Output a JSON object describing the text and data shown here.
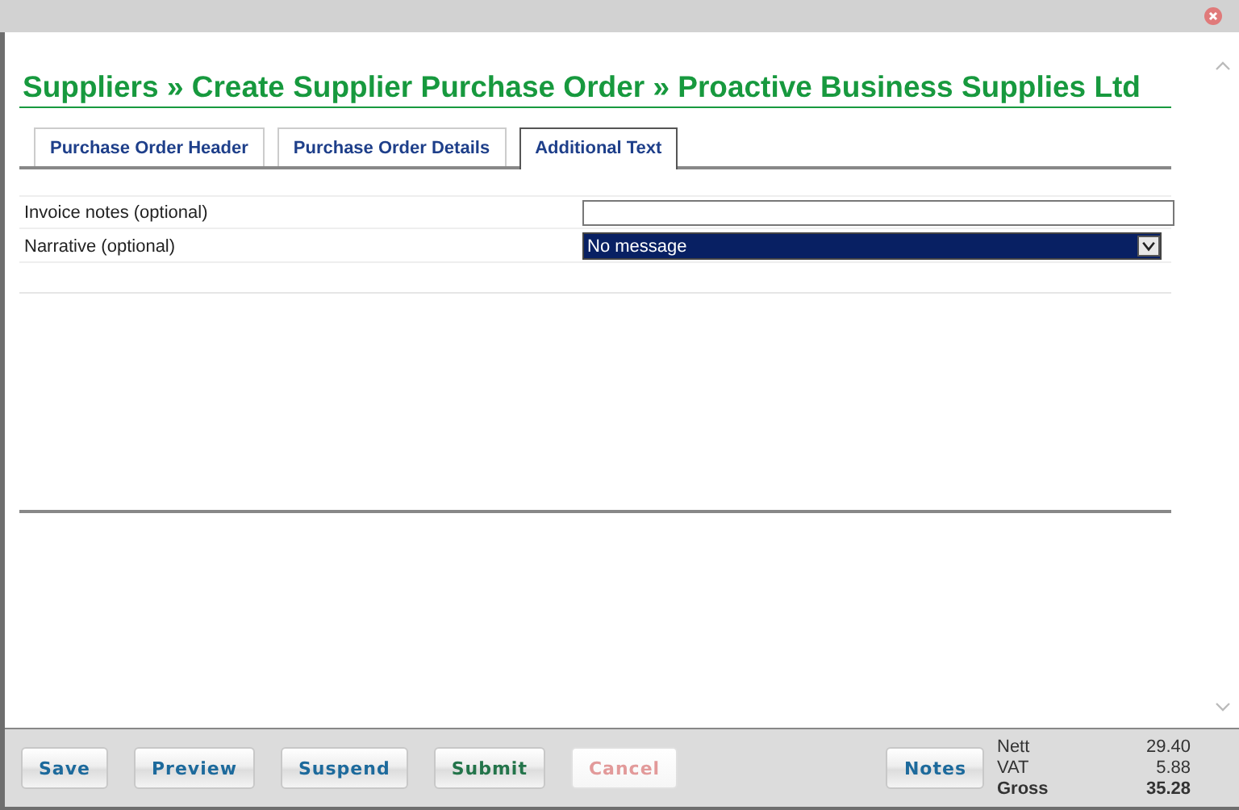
{
  "title": "Suppliers » Create Supplier Purchase Order » Proactive Business Supplies Ltd",
  "tabs": [
    {
      "label": "Purchase Order Header",
      "selected": false
    },
    {
      "label": "Purchase Order Details",
      "selected": false
    },
    {
      "label": "Additional Text",
      "selected": true
    }
  ],
  "fields": [
    {
      "kind": "text",
      "label": "Invoice notes (optional)"
    },
    {
      "kind": "select",
      "label": "Narrative (optional)",
      "value": "No message"
    }
  ],
  "buttons": [
    {
      "label": "Save",
      "color": "#1d6a9c",
      "disabled": false
    },
    {
      "label": "Preview",
      "color": "#1d6a9c",
      "disabled": false
    },
    {
      "label": "Suspend",
      "color": "#1d6a9c",
      "disabled": false
    },
    {
      "label": "Submit",
      "color": "#23744a",
      "disabled": false
    },
    {
      "label": "Cancel",
      "color": "#e29a9a",
      "disabled": true
    }
  ],
  "notes_button": {
    "label": "Notes",
    "color": "#1d6a9c"
  },
  "totals": [
    {
      "label": "Nett",
      "value": "29.40",
      "emphasis": false
    },
    {
      "label": "VAT",
      "value": "5.88",
      "emphasis": false
    },
    {
      "label": "Gross",
      "value": "35.28",
      "emphasis": true
    }
  ]
}
